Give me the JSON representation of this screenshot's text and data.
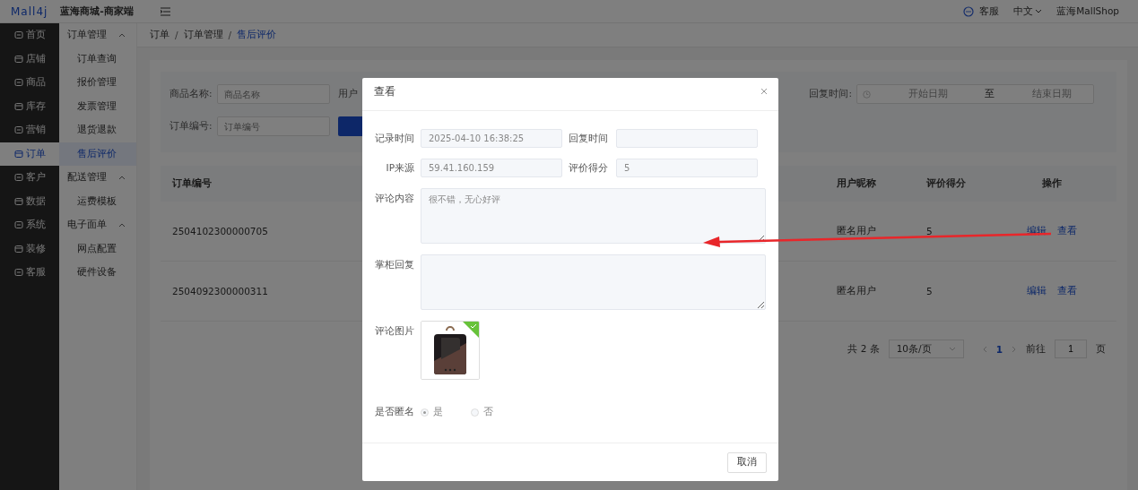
{
  "header": {
    "logo": "Mall4j",
    "title": "蓝海商城-商家端",
    "service": "客服",
    "language": "中文",
    "user": "蓝海MallShop"
  },
  "main_nav": [
    {
      "label": "首页",
      "selected": false
    },
    {
      "label": "店铺",
      "selected": false
    },
    {
      "label": "商品",
      "selected": false
    },
    {
      "label": "库存",
      "selected": false
    },
    {
      "label": "营销",
      "selected": false
    },
    {
      "label": "订单",
      "selected": true
    },
    {
      "label": "客户",
      "selected": false
    },
    {
      "label": "数据",
      "selected": false
    },
    {
      "label": "系统",
      "selected": false
    },
    {
      "label": "装修",
      "selected": false
    },
    {
      "label": "客服",
      "selected": false
    }
  ],
  "sub_nav": [
    {
      "label": "订单管理",
      "expanded": true,
      "children": [
        {
          "label": "订单查询",
          "selected": false
        },
        {
          "label": "报价管理",
          "selected": false
        },
        {
          "label": "发票管理",
          "selected": false
        },
        {
          "label": "退货退款",
          "selected": false
        },
        {
          "label": "售后评价",
          "selected": true
        }
      ]
    },
    {
      "label": "配送管理",
      "expanded": true,
      "children": [
        {
          "label": "运费模板",
          "selected": false
        }
      ]
    },
    {
      "label": "电子面单",
      "expanded": true,
      "children": [
        {
          "label": "网点配置",
          "selected": false
        },
        {
          "label": "硬件设备",
          "selected": false
        }
      ]
    }
  ],
  "breadcrumb_separators": [
    "/",
    "/"
  ],
  "breadcrumb": [
    {
      "label": "订单",
      "current": false
    },
    {
      "label": "订单管理",
      "current": false
    },
    {
      "label": "售后评价",
      "current": true
    }
  ],
  "filters": {
    "fields": [
      {
        "label": "商品名称:",
        "placeholder": "商品名称"
      },
      {
        "label": "订单编号:",
        "placeholder": "订单编号"
      }
    ],
    "partial_label": "用户",
    "reply_time": {
      "label": "回复时间:",
      "start_placeholder": "开始日期",
      "separator": "至",
      "end_placeholder": "结束日期"
    }
  },
  "table": {
    "columns": [
      "订单编号",
      "用户昵称",
      "评价得分",
      "操作"
    ],
    "rows": [
      {
        "order_no": "2504102300000705",
        "nickname": "匿名用户",
        "score": "5",
        "actions": [
          "编辑",
          "查看"
        ]
      },
      {
        "order_no": "2504092300000311",
        "nickname": "匿名用户",
        "score": "5",
        "actions": [
          "编辑",
          "查看"
        ]
      }
    ]
  },
  "pagination": {
    "total": "共 2 条",
    "page_size": "10条/页",
    "pages": [
      {
        "label": "1",
        "selected": true
      }
    ],
    "goto_label": "前往",
    "goto_value": "1",
    "page_suffix": "页"
  },
  "dialog": {
    "title": "查看",
    "fields": [
      {
        "label": "记录时间",
        "value": "2025-04-10 16:38:25"
      },
      {
        "label": "回复时间"
      },
      {
        "label": "IP来源",
        "value": "59.41.160.159"
      },
      {
        "label": "评价得分",
        "value": "5"
      }
    ],
    "content": {
      "label": "评论内容",
      "value": "很不错，无心好评"
    },
    "reply": {
      "label": "掌柜回复"
    },
    "images": {
      "label": "评论图片",
      "items": [
        {
          "kind": "picture",
          "uploaded": true
        }
      ]
    },
    "anonymous": {
      "label": "是否匿名",
      "options": [
        {
          "label": "是",
          "selected": true
        },
        {
          "label": "否",
          "selected": false
        }
      ]
    },
    "buttons": [
      "取消"
    ]
  }
}
